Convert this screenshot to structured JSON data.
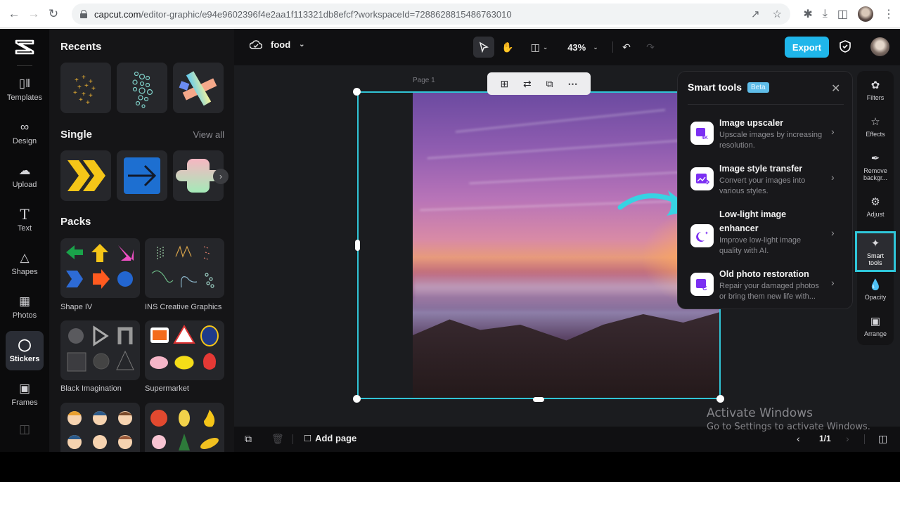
{
  "browser": {
    "url_domain": "capcut.com",
    "url_path": "/editor-graphic/e94e9602396f4e2aa1f113321db8efcf?workspaceId=7288628815486763010",
    "icons": [
      "back-icon",
      "forward-icon",
      "reload-icon",
      "lock-icon",
      "share-icon",
      "bookmark-star-icon",
      "extensions-icon",
      "download-icon",
      "side-panel-icon",
      "profile-avatar",
      "menu-kebab-icon"
    ]
  },
  "rail": {
    "items": [
      {
        "label": "Templates",
        "icon": "templates-icon"
      },
      {
        "label": "Design",
        "icon": "design-icon"
      },
      {
        "label": "Upload",
        "icon": "upload-icon"
      },
      {
        "label": "Text",
        "icon": "text-icon"
      },
      {
        "label": "Shapes",
        "icon": "shapes-icon"
      },
      {
        "label": "Photos",
        "icon": "photos-icon"
      },
      {
        "label": "Stickers",
        "icon": "stickers-icon",
        "active": true
      },
      {
        "label": "Frames",
        "icon": "frames-icon"
      }
    ]
  },
  "panel": {
    "recents_title": "Recents",
    "single_title": "Single",
    "view_all": "View all",
    "packs_title": "Packs",
    "recents": [
      "yellow-sparkles-sticker",
      "teal-bubbles-sticker",
      "pastel-cross-sticker"
    ],
    "singles": [
      "yellow-chevrons-sticker",
      "blue-arrow-sticker",
      "gradient-flower-sticker"
    ],
    "packs": [
      {
        "label": "Shape IV"
      },
      {
        "label": "INS Creative Graphics"
      },
      {
        "label": "Black Imagination"
      },
      {
        "label": "Supermarket"
      },
      {
        "label": ""
      },
      {
        "label": ""
      }
    ]
  },
  "topbar": {
    "doc_name": "food",
    "zoom": "43%",
    "export": "Export"
  },
  "canvas": {
    "page_label": "Page 1"
  },
  "smart_tools": {
    "title": "Smart tools",
    "badge": "Beta",
    "items": [
      {
        "title": "Image upscaler",
        "desc": "Upscale images by increasing resolution."
      },
      {
        "title": "Image style transfer",
        "desc": "Convert your images into various styles."
      },
      {
        "title": "Low-light image enhancer",
        "desc": "Improve low-light image quality with AI."
      },
      {
        "title": "Old photo restoration",
        "desc": "Repair your damaged photos or bring them new life with..."
      }
    ]
  },
  "right_rail": {
    "items": [
      {
        "label": "Filters"
      },
      {
        "label": "Effects"
      },
      {
        "label": "Remove backgr..."
      },
      {
        "label": "Adjust"
      },
      {
        "label": "Smart tools",
        "active": true
      },
      {
        "label": "Opacity"
      },
      {
        "label": "Arrange"
      }
    ]
  },
  "bottombar": {
    "add_page": "Add page",
    "pager": "1/1"
  },
  "watermark": {
    "line1": "Activate Windows",
    "line2": "Go to Settings to activate Windows."
  },
  "colors": {
    "accent": "#1fb6ea",
    "selection": "#31c4d6",
    "tool_icon": "#7b2ff2"
  }
}
